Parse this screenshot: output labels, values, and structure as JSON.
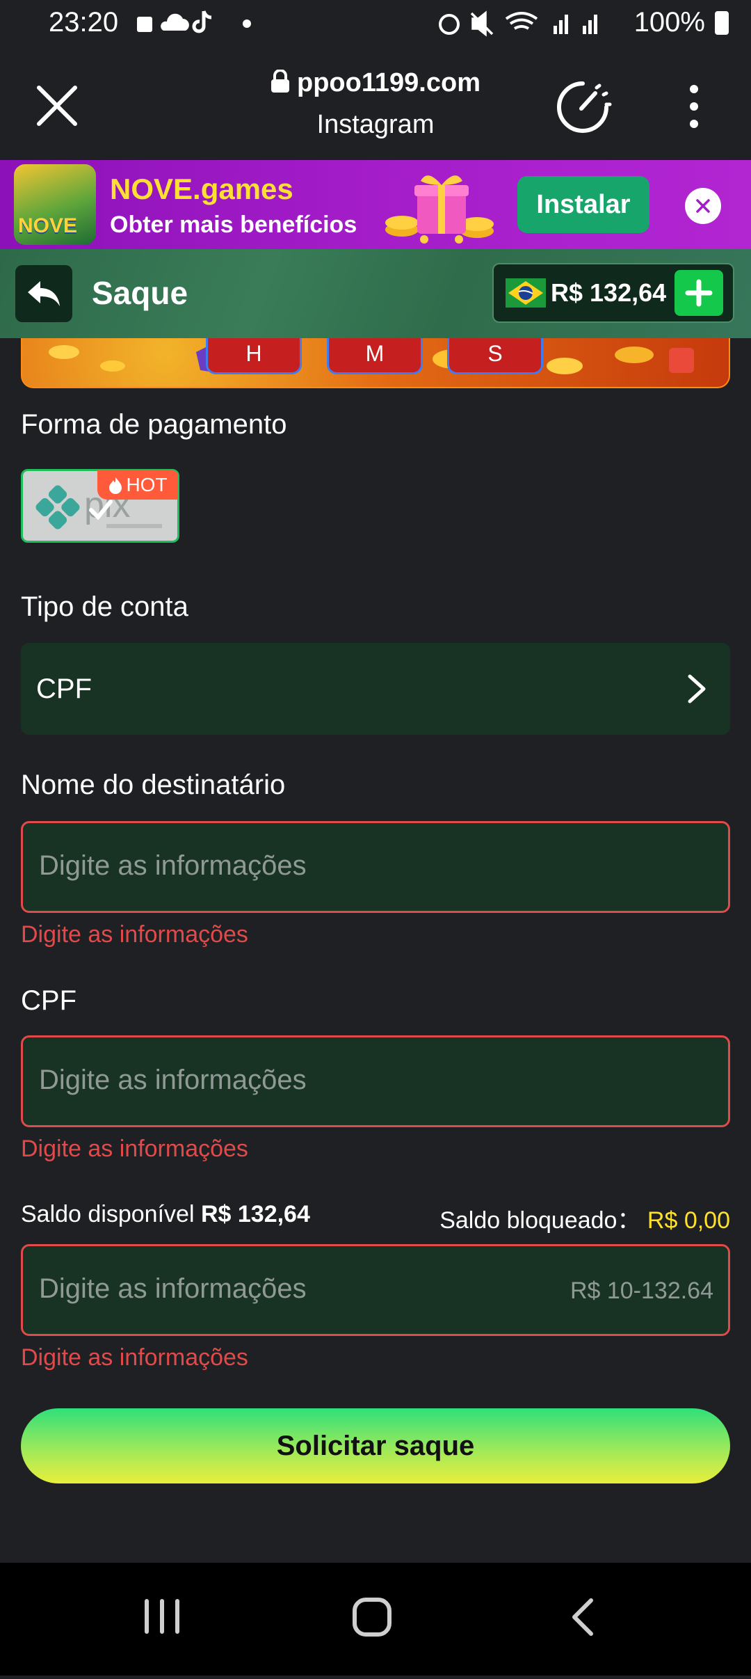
{
  "status_bar": {
    "time": "23:20",
    "battery": "100%",
    "icons": [
      "lock-icon",
      "cloud-icon",
      "tiktok-icon",
      "dot-icon",
      "alarm-icon",
      "mute-icon",
      "wifi-icon",
      "signal-icon",
      "signal-icon",
      "battery-icon"
    ]
  },
  "browser": {
    "domain": "ppoo1199.com",
    "subtitle": "Instagram"
  },
  "app_banner": {
    "title": "NOVE.games",
    "subtitle": "Obter mais benefícios",
    "install_label": "Instalar",
    "logo_text": "NOVE"
  },
  "header": {
    "title": "Saque",
    "balance": "R$ 132,64"
  },
  "game_strip": {
    "timer_labels": [
      "H",
      "M",
      "S"
    ]
  },
  "form": {
    "payment_label": "Forma de pagamento",
    "payment_method": "pix",
    "hot_badge": "HOT",
    "account_type_label": "Tipo de conta",
    "account_type_value": "CPF",
    "recipient_label": "Nome do destinatário",
    "recipient_placeholder": "Digite as informações",
    "recipient_error": "Digite as informações",
    "cpf_label": "CPF",
    "cpf_placeholder": "Digite as informações",
    "cpf_error": "Digite as informações",
    "available_label": "Saldo disponível",
    "available_value": "R$ 132,64",
    "blocked_label": "Saldo bloqueado：",
    "blocked_value": "R$ 0,00",
    "amount_placeholder": "Digite as informações",
    "amount_range": "R$ 10-132.64",
    "amount_error": "Digite as informações",
    "submit_label": "Solicitar saque"
  },
  "colors": {
    "background": "#1f2024",
    "accent_green": "#13c84a",
    "error_red": "#e04a4a",
    "field_bg": "#183224",
    "banner_purple": "#a21cc8",
    "blocked_yellow": "#ffe02a"
  }
}
